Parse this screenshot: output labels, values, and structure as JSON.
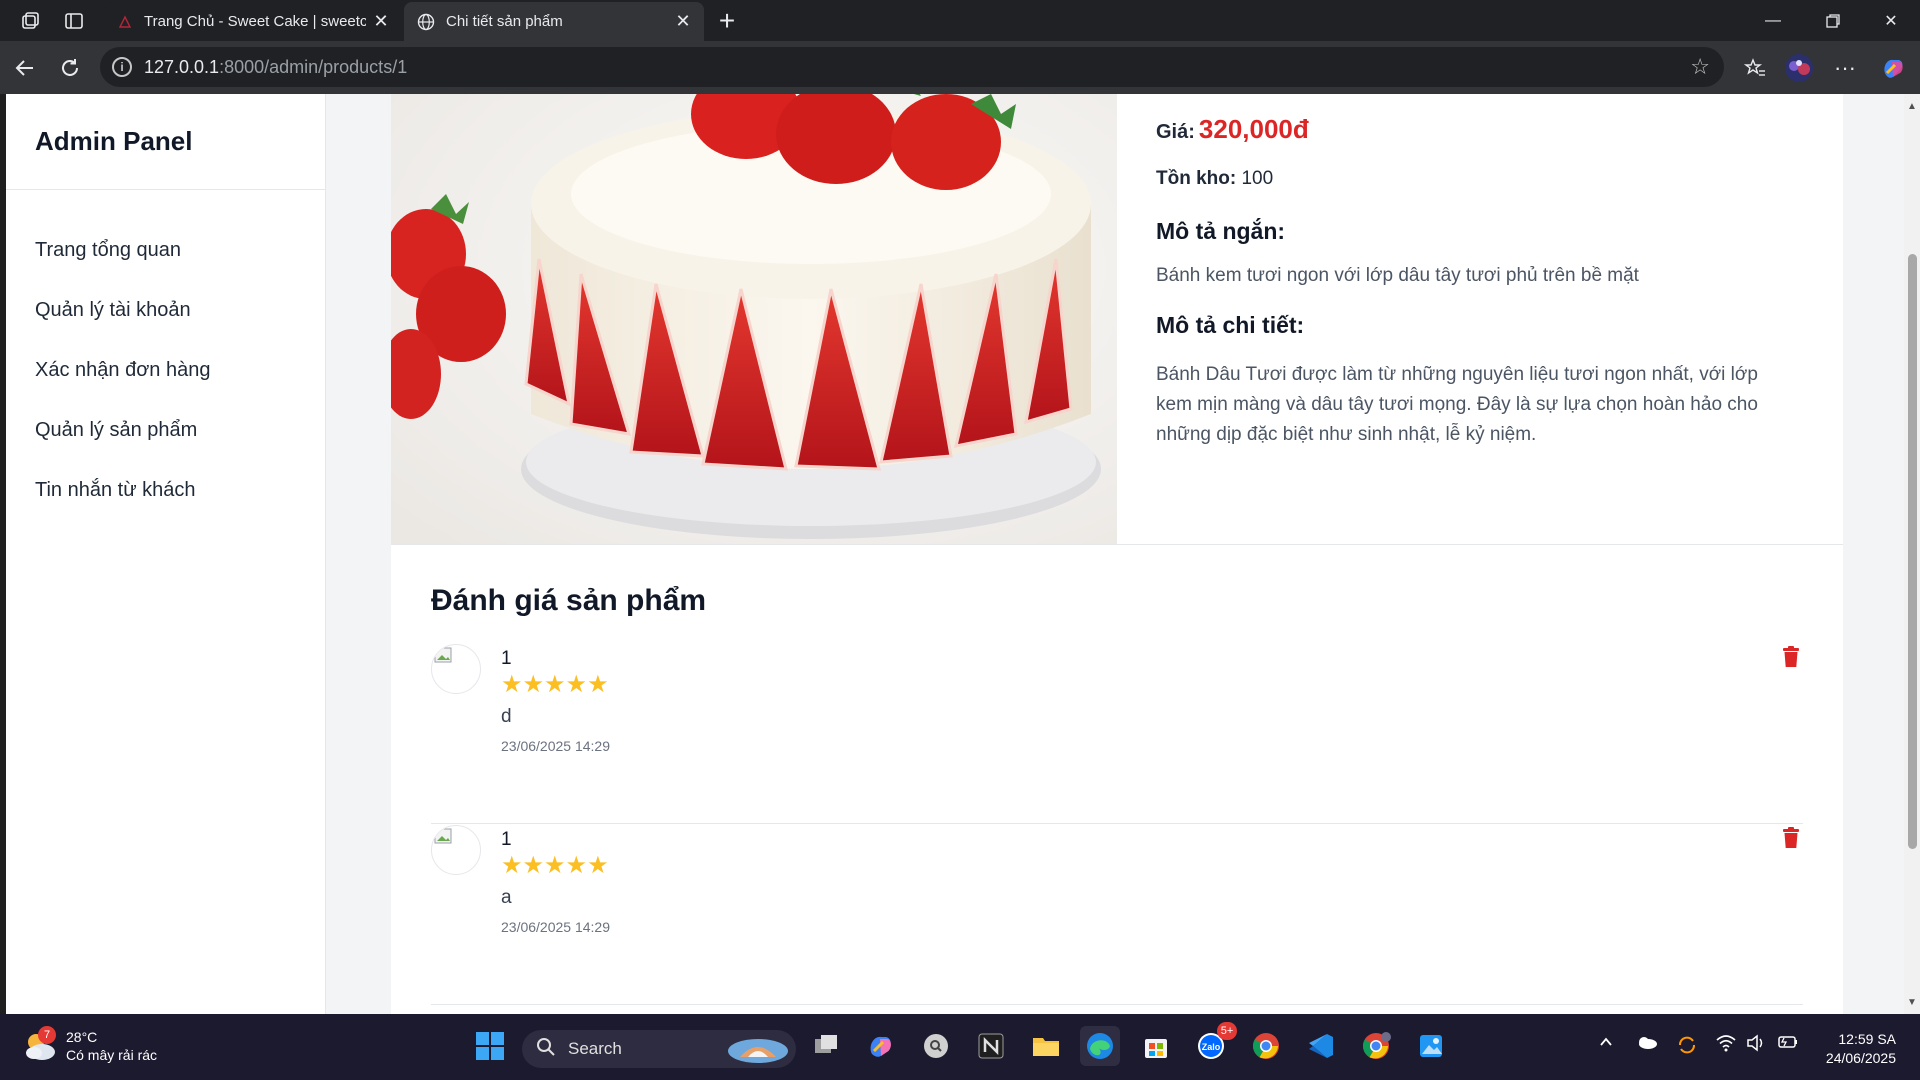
{
  "browser": {
    "tabs": [
      {
        "title": "Trang Chủ - Sweet Cake | sweetca",
        "active": false
      },
      {
        "title": "Chi tiết sản phẩm",
        "active": true
      }
    ],
    "url_host": "127.0.0.1",
    "url_rest": ":8000/admin/products/1"
  },
  "sidebar": {
    "title": "Admin Panel",
    "items": [
      {
        "label": "Trang tổng quan"
      },
      {
        "label": "Quản lý tài khoản"
      },
      {
        "label": "Xác nhận đơn hàng"
      },
      {
        "label": "Quản lý sản phẩm"
      },
      {
        "label": "Tin nhắn từ khách"
      }
    ]
  },
  "product": {
    "price_label": "Giá:",
    "price_value": "320,000đ",
    "stock_label": "Tồn kho:",
    "stock_value": "100",
    "short_desc_heading": "Mô tả ngắn:",
    "short_desc": "Bánh kem tươi ngon với lớp dâu tây tươi phủ trên bề mặt",
    "long_desc_heading": "Mô tả chi tiết:",
    "long_desc": "Bánh Dâu Tươi được làm từ những nguyên liệu tươi ngon nhất, với lớp kem mịn màng và dâu tây tươi mọng. Đây là sự lựa chọn hoàn hảo cho những dịp đặc biệt như sinh nhật, lễ kỷ niệm."
  },
  "reviews": {
    "heading": "Đánh giá sản phẩm",
    "items": [
      {
        "name": "1",
        "stars": "★★★★★",
        "rating": 5,
        "text": "d",
        "date": "23/06/2025 14:29"
      },
      {
        "name": "1",
        "stars": "★★★★★",
        "rating": 5,
        "text": "a",
        "date": "23/06/2025 14:29"
      }
    ]
  },
  "taskbar": {
    "weather_temp": "28°C",
    "weather_desc": "Có mây rải rác",
    "weather_badge": "7",
    "search_label": "Search",
    "zalo_badge": "5+",
    "time": "12:59 SA",
    "date": "24/06/2025"
  },
  "colors": {
    "price": "#dc2626",
    "star": "#fbbf24",
    "trash": "#dc2626"
  }
}
